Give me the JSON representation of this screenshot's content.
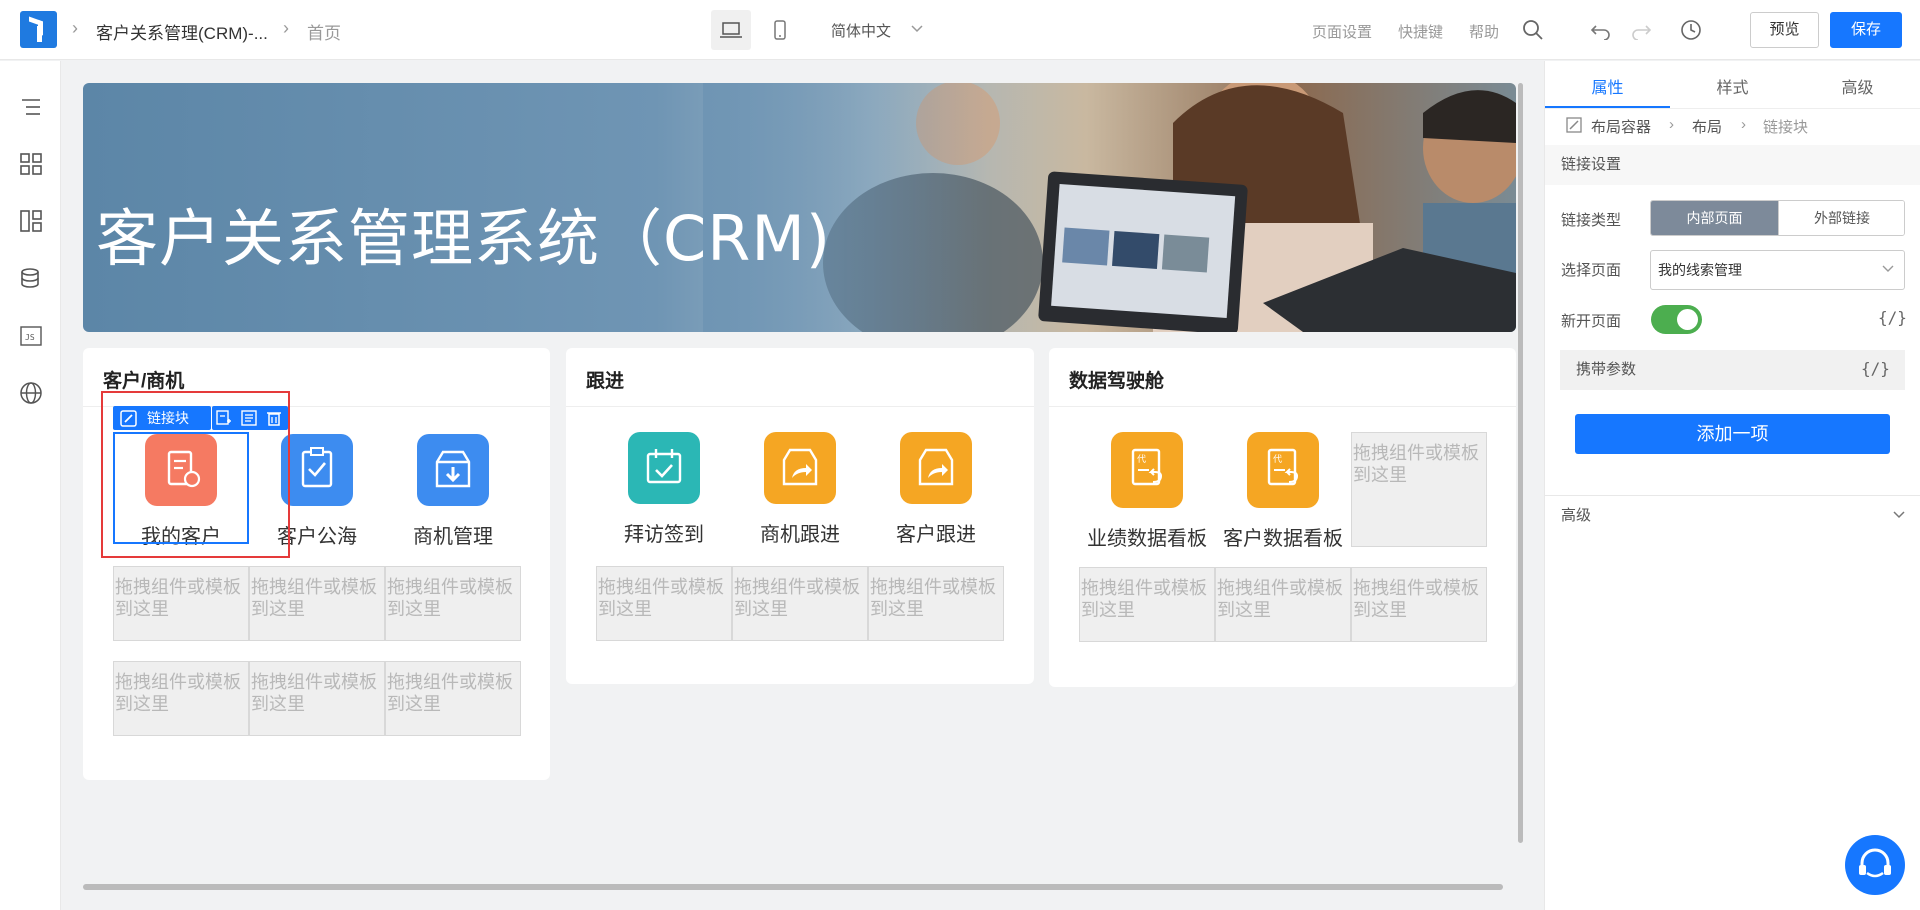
{
  "topbar": {
    "crumbs": [
      "客户关系管理(CRM)-...",
      "首页"
    ],
    "lang": "简体中文",
    "links": [
      "页面设置",
      "快捷键",
      "帮助"
    ],
    "preview": "预览",
    "save": "保存"
  },
  "banner": {
    "title": "客户关系管理系统（CRM)"
  },
  "cards": [
    {
      "title": "客户/商机",
      "tiles": [
        "我的客户",
        "客户公海",
        "商机管理"
      ]
    },
    {
      "title": "跟进",
      "tiles": [
        "拜访签到",
        "商机跟进",
        "客户跟进"
      ]
    },
    {
      "title": "数据驾驶舱",
      "tiles": [
        "业绩数据看板",
        "客户数据看板"
      ]
    }
  ],
  "dropzone": "拖拽组件或模板到这里",
  "selection": {
    "chip": "链接块"
  },
  "right": {
    "tabs": [
      "属性",
      "样式",
      "高级"
    ],
    "crumbs": [
      "布局容器",
      "布局",
      "链接块"
    ],
    "section_link": "链接设置",
    "link_type_label": "链接类型",
    "link_type_options": [
      "内部页面",
      "外部链接"
    ],
    "select_page_label": "选择页面",
    "select_page_value": "我的线索管理",
    "new_page_label": "新开页面",
    "params_label": "携带参数",
    "add_item": "添加一项",
    "section_adv": "高级",
    "code_icon": "{/}"
  },
  "colors": {
    "accent": "#1677ff",
    "red_icon": "#f57a62",
    "blue_icon": "#3d8cf0",
    "teal_icon": "#2bb7b5",
    "orange_icon": "#f5a623"
  }
}
